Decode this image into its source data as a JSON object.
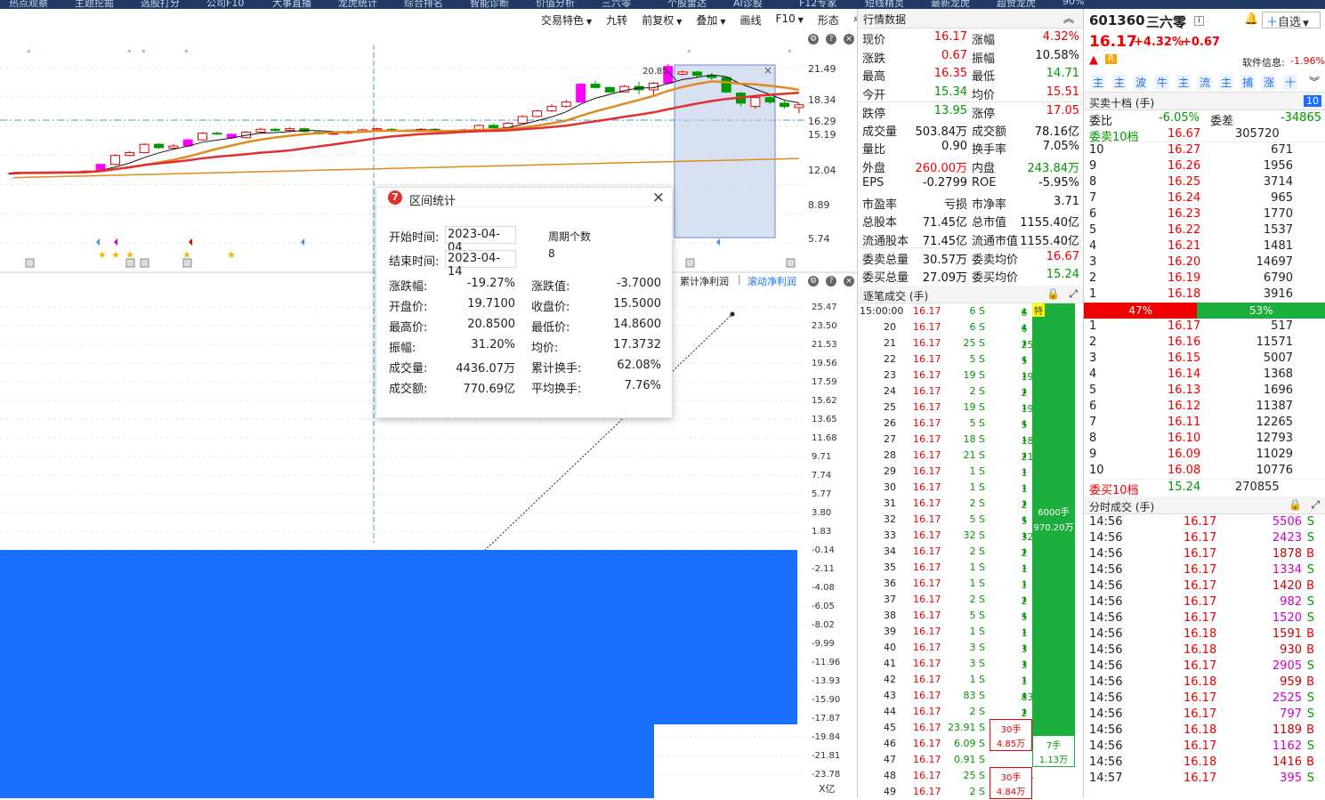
{
  "topbar": {
    "items": [
      "热点观察",
      "主题挖掘",
      "选股打分",
      "公司F10",
      "大事直播",
      "龙虎统计",
      "综合排名",
      "智能诊断",
      "价值分析",
      "三六零",
      "个股雷达",
      "AI诊股",
      "F12专家",
      "短线精灵",
      "最新龙虎",
      "超赞龙虎",
      "90%"
    ]
  },
  "toolbar": {
    "items": [
      {
        "label": "交易特色",
        "caret": true
      },
      {
        "label": "九转",
        "caret": false
      },
      {
        "label": "前复权",
        "caret": true
      },
      {
        "label": "叠加",
        "caret": true
      },
      {
        "label": "画线",
        "caret": false
      },
      {
        "label": "F10",
        "caret": true
      },
      {
        "label": "形态",
        "caret": false
      }
    ],
    "more": "»"
  },
  "kline": {
    "price_labels": [
      "21.49",
      "18.34",
      "16.29",
      "15.19",
      "12.04",
      "8.89",
      "5.74"
    ],
    "high_label": "20.85",
    "indicator_tabs": [
      "累计净利润",
      "滚动净利润"
    ],
    "indicator_labels": [
      "25.47",
      "23.50",
      "21.53",
      "19.56",
      "17.59",
      "15.62",
      "13.65",
      "11.68",
      "9.71",
      "7.74",
      "5.77",
      "3.80",
      "1.83",
      "-0.14",
      "-2.11",
      "-4.08",
      "-6.05",
      "-8.02",
      "-9.99",
      "-11.96",
      "-13.93",
      "-15.90",
      "-17.87",
      "-19.84",
      "-21.81",
      "-23.78"
    ],
    "unit": "X亿",
    "candles": [
      {
        "o": 11.55,
        "c": 11.62,
        "h": 11.7,
        "l": 11.5
      },
      {
        "o": 11.6,
        "c": 11.65,
        "h": 11.72,
        "l": 11.55
      },
      {
        "o": 11.62,
        "c": 11.68,
        "h": 11.75,
        "l": 11.58
      },
      {
        "o": 11.66,
        "c": 11.7,
        "h": 11.78,
        "l": 11.62
      },
      {
        "o": 11.7,
        "c": 11.72,
        "h": 11.8,
        "l": 11.65
      },
      {
        "o": 11.7,
        "c": 11.8,
        "h": 11.85,
        "l": 11.66
      },
      {
        "o": 11.8,
        "c": 12.4,
        "h": 12.45,
        "l": 11.78
      },
      {
        "o": 12.4,
        "c": 13.2,
        "h": 13.3,
        "l": 12.35
      },
      {
        "o": 13.2,
        "c": 13.45,
        "h": 13.6,
        "l": 13.1
      },
      {
        "o": 13.45,
        "c": 14.2,
        "h": 14.3,
        "l": 13.4
      },
      {
        "o": 14.2,
        "c": 13.9,
        "h": 14.3,
        "l": 13.8
      },
      {
        "o": 13.85,
        "c": 14.05,
        "h": 14.2,
        "l": 13.7
      },
      {
        "o": 14.05,
        "c": 14.6,
        "h": 14.7,
        "l": 13.95
      },
      {
        "o": 14.6,
        "c": 15.2,
        "h": 15.3,
        "l": 14.55
      },
      {
        "o": 15.2,
        "c": 15.15,
        "h": 15.35,
        "l": 15.05
      },
      {
        "o": 15.1,
        "c": 14.8,
        "h": 15.2,
        "l": 14.7
      },
      {
        "o": 14.8,
        "c": 15.3,
        "h": 15.4,
        "l": 14.75
      },
      {
        "o": 15.3,
        "c": 15.55,
        "h": 15.7,
        "l": 15.2
      },
      {
        "o": 15.55,
        "c": 15.45,
        "h": 15.7,
        "l": 15.35
      },
      {
        "o": 15.45,
        "c": 15.6,
        "h": 15.75,
        "l": 15.4
      },
      {
        "o": 15.6,
        "c": 15.35,
        "h": 15.7,
        "l": 15.25
      },
      {
        "o": 15.3,
        "c": 15.15,
        "h": 15.4,
        "l": 15.05
      },
      {
        "o": 15.15,
        "c": 15.2,
        "h": 15.3,
        "l": 15.05
      },
      {
        "o": 15.2,
        "c": 15.35,
        "h": 15.45,
        "l": 15.1
      },
      {
        "o": 15.35,
        "c": 15.5,
        "h": 15.6,
        "l": 15.25
      },
      {
        "o": 15.5,
        "c": 15.6,
        "h": 15.7,
        "l": 15.4
      },
      {
        "o": 15.55,
        "c": 15.4,
        "h": 15.65,
        "l": 15.3
      },
      {
        "o": 15.4,
        "c": 15.45,
        "h": 15.55,
        "l": 15.3
      },
      {
        "o": 15.45,
        "c": 15.55,
        "h": 15.65,
        "l": 15.35
      },
      {
        "o": 15.55,
        "c": 15.4,
        "h": 15.65,
        "l": 15.3
      },
      {
        "o": 15.35,
        "c": 15.3,
        "h": 15.45,
        "l": 15.2
      },
      {
        "o": 15.3,
        "c": 15.5,
        "h": 15.6,
        "l": 15.2
      },
      {
        "o": 15.5,
        "c": 15.9,
        "h": 16.0,
        "l": 15.45
      },
      {
        "o": 15.9,
        "c": 15.7,
        "h": 16.05,
        "l": 15.6
      },
      {
        "o": 15.7,
        "c": 16.1,
        "h": 16.2,
        "l": 15.65
      },
      {
        "o": 16.1,
        "c": 16.7,
        "h": 16.8,
        "l": 16.05
      },
      {
        "o": 16.7,
        "c": 17.2,
        "h": 17.3,
        "l": 16.6
      },
      {
        "o": 17.2,
        "c": 17.6,
        "h": 17.8,
        "l": 17.1
      },
      {
        "o": 17.6,
        "c": 18.0,
        "h": 18.2,
        "l": 17.5
      },
      {
        "o": 18.0,
        "c": 19.6,
        "h": 19.7,
        "l": 17.95
      },
      {
        "o": 19.6,
        "c": 19.3,
        "h": 19.9,
        "l": 19.2
      },
      {
        "o": 19.3,
        "c": 18.9,
        "h": 19.4,
        "l": 18.8
      },
      {
        "o": 18.9,
        "c": 19.4,
        "h": 19.55,
        "l": 18.85
      },
      {
        "o": 19.4,
        "c": 19.1,
        "h": 19.8,
        "l": 18.7
      },
      {
        "o": 19.1,
        "c": 19.7,
        "h": 19.8,
        "l": 18.6
      },
      {
        "o": 19.7,
        "c": 21.2,
        "h": 21.4,
        "l": 19.6
      },
      {
        "o": 20.5,
        "c": 20.7,
        "h": 20.85,
        "l": 20.4
      },
      {
        "o": 20.7,
        "c": 20.4,
        "h": 20.8,
        "l": 20.2
      },
      {
        "o": 20.4,
        "c": 20.2,
        "h": 20.6,
        "l": 20.0
      },
      {
        "o": 20.2,
        "c": 18.9,
        "h": 20.3,
        "l": 18.8
      },
      {
        "o": 18.8,
        "c": 17.9,
        "h": 18.9,
        "l": 17.6
      },
      {
        "o": 17.6,
        "c": 18.4,
        "h": 18.5,
        "l": 17.4
      },
      {
        "o": 18.4,
        "c": 18.0,
        "h": 18.6,
        "l": 17.8
      },
      {
        "o": 17.9,
        "c": 17.6,
        "h": 18.1,
        "l": 17.4
      },
      {
        "o": 17.5,
        "c": 17.75,
        "h": 17.9,
        "l": 17.0
      }
    ]
  },
  "stat": {
    "title": "区间统计",
    "start_label": "开始时间:",
    "start": "2023-04-04",
    "end_label": "结束时间:",
    "end": "2023-04-14",
    "period_label": "周期个数",
    "period": "8",
    "rows": [
      {
        "l1": "涨跌幅:",
        "v1": "-19.27%",
        "l2": "涨跌值:",
        "v2": "-3.7000"
      },
      {
        "l1": "开盘价:",
        "v1": "19.7100",
        "l2": "收盘价:",
        "v2": "15.5000"
      },
      {
        "l1": "最高价:",
        "v1": "20.8500",
        "l2": "最低价:",
        "v2": "14.8600"
      },
      {
        "l1": "振幅:",
        "v1": "31.20%",
        "l2": "均价:",
        "v2": "17.3732"
      },
      {
        "l1": "成交量:",
        "v1": "4436.07万",
        "l2": "累计换手:",
        "v2": "62.08%"
      },
      {
        "l1": "成交额:",
        "v1": "770.69亿",
        "l2": "平均换手:",
        "v2": "7.76%"
      }
    ]
  },
  "quote": {
    "title": "行情数据",
    "rows": [
      {
        "l1": "现价",
        "v1": "16.17",
        "c1": "red",
        "l2": "涨幅",
        "v2": "4.32%",
        "c2": "red"
      },
      {
        "l1": "涨跌",
        "v1": "0.67",
        "c1": "red",
        "l2": "振幅",
        "v2": "10.58%",
        "c2": "blk"
      },
      {
        "l1": "最高",
        "v1": "16.35",
        "c1": "red",
        "l2": "最低",
        "v2": "14.71",
        "c2": "grn"
      },
      {
        "l1": "今开",
        "v1": "15.34",
        "c1": "grn",
        "l2": "均价",
        "v2": "15.51",
        "c2": "red"
      },
      {
        "l1": "跌停",
        "v1": "13.95",
        "c1": "grn",
        "l2": "涨停",
        "v2": "17.05",
        "c2": "red"
      },
      {
        "l1": "成交量",
        "v1": "503.84万",
        "c1": "blk",
        "l2": "成交额",
        "v2": "78.16亿",
        "c2": "blk"
      },
      {
        "l1": "量比",
        "v1": "0.90",
        "c1": "blk",
        "l2": "换手率",
        "v2": "7.05%",
        "c2": "blk"
      },
      {
        "l1": "外盘",
        "v1": "260.00万",
        "c1": "red",
        "l2": "内盘",
        "v2": "243.84万",
        "c2": "grn"
      },
      {
        "l1": "EPS",
        "v1": "-0.2799",
        "c1": "blk",
        "l2": "ROE",
        "v2": "-5.95%",
        "c2": "blk"
      },
      {
        "l1": "市盈率",
        "v1": "亏损",
        "c1": "blk",
        "l2": "市净率",
        "v2": "3.71",
        "c2": "blk"
      },
      {
        "l1": "总股本",
        "v1": "71.45亿",
        "c1": "blk",
        "l2": "总市值",
        "v2": "1155.40亿",
        "c2": "blk"
      },
      {
        "l1": "流通股本",
        "v1": "71.45亿",
        "c1": "blk",
        "l2": "流通市值",
        "v2": "1155.40亿",
        "c2": "blk"
      },
      {
        "l1": "委卖总量",
        "v1": "30.57万",
        "c1": "blk",
        "l2": "委卖均价",
        "v2": "16.67",
        "c2": "red"
      },
      {
        "l1": "委买总量",
        "v1": "27.09万",
        "c1": "blk",
        "l2": "委买均价",
        "v2": "15.24",
        "c2": "grn"
      }
    ]
  },
  "ticks": {
    "title": "逐笔成交 (手)",
    "big_sell": {
      "badge": "特",
      "lots": "6000手",
      "amount": "970.20万"
    },
    "big_buy": {
      "lots": "7手",
      "amount": "1.13万"
    },
    "orders": [
      {
        "lots": "30手",
        "amount": "4.85万"
      },
      {
        "lots": "30手",
        "amount": "4.84万"
      }
    ],
    "rows": [
      {
        "t": "15:00:00",
        "p": "16.17",
        "v": "6 S",
        "q": "6"
      },
      {
        "t": "20",
        "p": "16.17",
        "v": "6 S",
        "q": "6"
      },
      {
        "t": "21",
        "p": "16.17",
        "v": "25 S",
        "q": "25"
      },
      {
        "t": "22",
        "p": "16.17",
        "v": "5 S",
        "q": "5"
      },
      {
        "t": "23",
        "p": "16.17",
        "v": "19 S",
        "q": "19"
      },
      {
        "t": "24",
        "p": "16.17",
        "v": "2 S",
        "q": "2"
      },
      {
        "t": "25",
        "p": "16.17",
        "v": "19 S",
        "q": "19"
      },
      {
        "t": "26",
        "p": "16.17",
        "v": "5 S",
        "q": "5"
      },
      {
        "t": "27",
        "p": "16.17",
        "v": "18 S",
        "q": "18"
      },
      {
        "t": "28",
        "p": "16.17",
        "v": "21 S",
        "q": "21"
      },
      {
        "t": "29",
        "p": "16.17",
        "v": "1 S",
        "q": "1"
      },
      {
        "t": "30",
        "p": "16.17",
        "v": "1 S",
        "q": "1"
      },
      {
        "t": "31",
        "p": "16.17",
        "v": "2 S",
        "q": "2"
      },
      {
        "t": "32",
        "p": "16.17",
        "v": "5 S",
        "q": "5"
      },
      {
        "t": "33",
        "p": "16.17",
        "v": "32 S",
        "q": "32"
      },
      {
        "t": "34",
        "p": "16.17",
        "v": "2 S",
        "q": "2"
      },
      {
        "t": "35",
        "p": "16.17",
        "v": "1 S",
        "q": "1"
      },
      {
        "t": "36",
        "p": "16.17",
        "v": "1 S",
        "q": "1"
      },
      {
        "t": "37",
        "p": "16.17",
        "v": "2 S",
        "q": "2"
      },
      {
        "t": "38",
        "p": "16.17",
        "v": "5 S",
        "q": "5"
      },
      {
        "t": "39",
        "p": "16.17",
        "v": "1 S",
        "q": "1"
      },
      {
        "t": "40",
        "p": "16.17",
        "v": "3 S",
        "q": "3"
      },
      {
        "t": "41",
        "p": "16.17",
        "v": "3 S",
        "q": "3"
      },
      {
        "t": "42",
        "p": "16.17",
        "v": "1 S",
        "q": "1"
      },
      {
        "t": "43",
        "p": "16.17",
        "v": "83 S",
        "q": "83"
      },
      {
        "t": "44",
        "p": "16.17",
        "v": "2 S",
        "q": "2"
      },
      {
        "t": "45",
        "p": "16.17",
        "v": "23.91 S",
        "q": ""
      },
      {
        "t": "46",
        "p": "16.17",
        "v": "6.09 S",
        "q": ""
      },
      {
        "t": "47",
        "p": "16.17",
        "v": "0.91 S",
        "q": ""
      },
      {
        "t": "48",
        "p": "16.17",
        "v": "25 S",
        "q": "25"
      },
      {
        "t": "49",
        "p": "16.17",
        "v": "2 S",
        "q": "2"
      }
    ]
  },
  "stock": {
    "code": "601360",
    "name": "三六零",
    "price": "16.17",
    "pct": "+4.32%",
    "chg": "+0.67",
    "add_label": "自选",
    "soft_label": "软件信息:",
    "soft_value": "-1.96%",
    "tags": [
      "主",
      "主",
      "波",
      "牛",
      "主",
      "流",
      "主",
      "捕",
      "涨",
      "十"
    ],
    "book_title": "买卖十档 (手)",
    "book_badge": "10",
    "wb_label": "委比",
    "wb": "-6.05%",
    "wc_label": "委差",
    "wc": "-34865",
    "sell10_label": "委卖10档",
    "sell10_price": "16.67",
    "sell10_vol": "305720",
    "asks": [
      {
        "n": "10",
        "p": "16.27",
        "v": "671"
      },
      {
        "n": "9",
        "p": "16.26",
        "v": "1956"
      },
      {
        "n": "8",
        "p": "16.25",
        "v": "3714"
      },
      {
        "n": "7",
        "p": "16.24",
        "v": "965"
      },
      {
        "n": "6",
        "p": "16.23",
        "v": "1770"
      },
      {
        "n": "5",
        "p": "16.22",
        "v": "1537"
      },
      {
        "n": "4",
        "p": "16.21",
        "v": "1481"
      },
      {
        "n": "3",
        "p": "16.20",
        "v": "14697"
      },
      {
        "n": "2",
        "p": "16.19",
        "v": "6790"
      },
      {
        "n": "1",
        "p": "16.18",
        "v": "3916"
      }
    ],
    "ratio_sell": "47%",
    "ratio_buy": "53%",
    "ratio_value": 0.47,
    "bids": [
      {
        "n": "1",
        "p": "16.17",
        "v": "517"
      },
      {
        "n": "2",
        "p": "16.16",
        "v": "11571"
      },
      {
        "n": "3",
        "p": "16.15",
        "v": "5007"
      },
      {
        "n": "4",
        "p": "16.14",
        "v": "1368"
      },
      {
        "n": "5",
        "p": "16.13",
        "v": "1696"
      },
      {
        "n": "6",
        "p": "16.12",
        "v": "11387"
      },
      {
        "n": "7",
        "p": "16.11",
        "v": "12265"
      },
      {
        "n": "8",
        "p": "16.10",
        "v": "12793"
      },
      {
        "n": "9",
        "p": "16.09",
        "v": "11029"
      },
      {
        "n": "10",
        "p": "16.08",
        "v": "10776"
      }
    ],
    "buy10_label": "委买10档",
    "buy10_price": "15.24",
    "buy10_vol": "270855",
    "fs_title": "分时成交 (手)",
    "fs": [
      {
        "t": "14:56",
        "p": "16.17",
        "v": "5506",
        "s": "S"
      },
      {
        "t": "14:56",
        "p": "16.17",
        "v": "2423",
        "s": "S"
      },
      {
        "t": "14:56",
        "p": "16.17",
        "v": "1878",
        "s": "B"
      },
      {
        "t": "14:56",
        "p": "16.17",
        "v": "1334",
        "s": "S"
      },
      {
        "t": "14:56",
        "p": "16.17",
        "v": "1420",
        "s": "B"
      },
      {
        "t": "14:56",
        "p": "16.17",
        "v": "982",
        "s": "S"
      },
      {
        "t": "14:56",
        "p": "16.17",
        "v": "1520",
        "s": "S"
      },
      {
        "t": "14:56",
        "p": "16.18",
        "v": "1591",
        "s": "B"
      },
      {
        "t": "14:56",
        "p": "16.18",
        "v": "930",
        "s": "B"
      },
      {
        "t": "14:56",
        "p": "16.17",
        "v": "2905",
        "s": "S"
      },
      {
        "t": "14:56",
        "p": "16.18",
        "v": "959",
        "s": "B"
      },
      {
        "t": "14:56",
        "p": "16.17",
        "v": "2525",
        "s": "S"
      },
      {
        "t": "14:56",
        "p": "16.17",
        "v": "797",
        "s": "S"
      },
      {
        "t": "14:56",
        "p": "16.18",
        "v": "1189",
        "s": "B"
      },
      {
        "t": "14:56",
        "p": "16.17",
        "v": "1162",
        "s": "S"
      },
      {
        "t": "14:56",
        "p": "16.18",
        "v": "1416",
        "s": "B"
      },
      {
        "t": "14:57",
        "p": "16.17",
        "v": "395",
        "s": "S"
      }
    ]
  },
  "colors": {
    "up": "#e00000",
    "down": "#009900",
    "magenta": "#ff00ff",
    "accent": "#1a6fff",
    "ma5": "#111111",
    "ma10": "#e08a20",
    "ma20": "#e03030",
    "ma60": "#e08a20"
  }
}
